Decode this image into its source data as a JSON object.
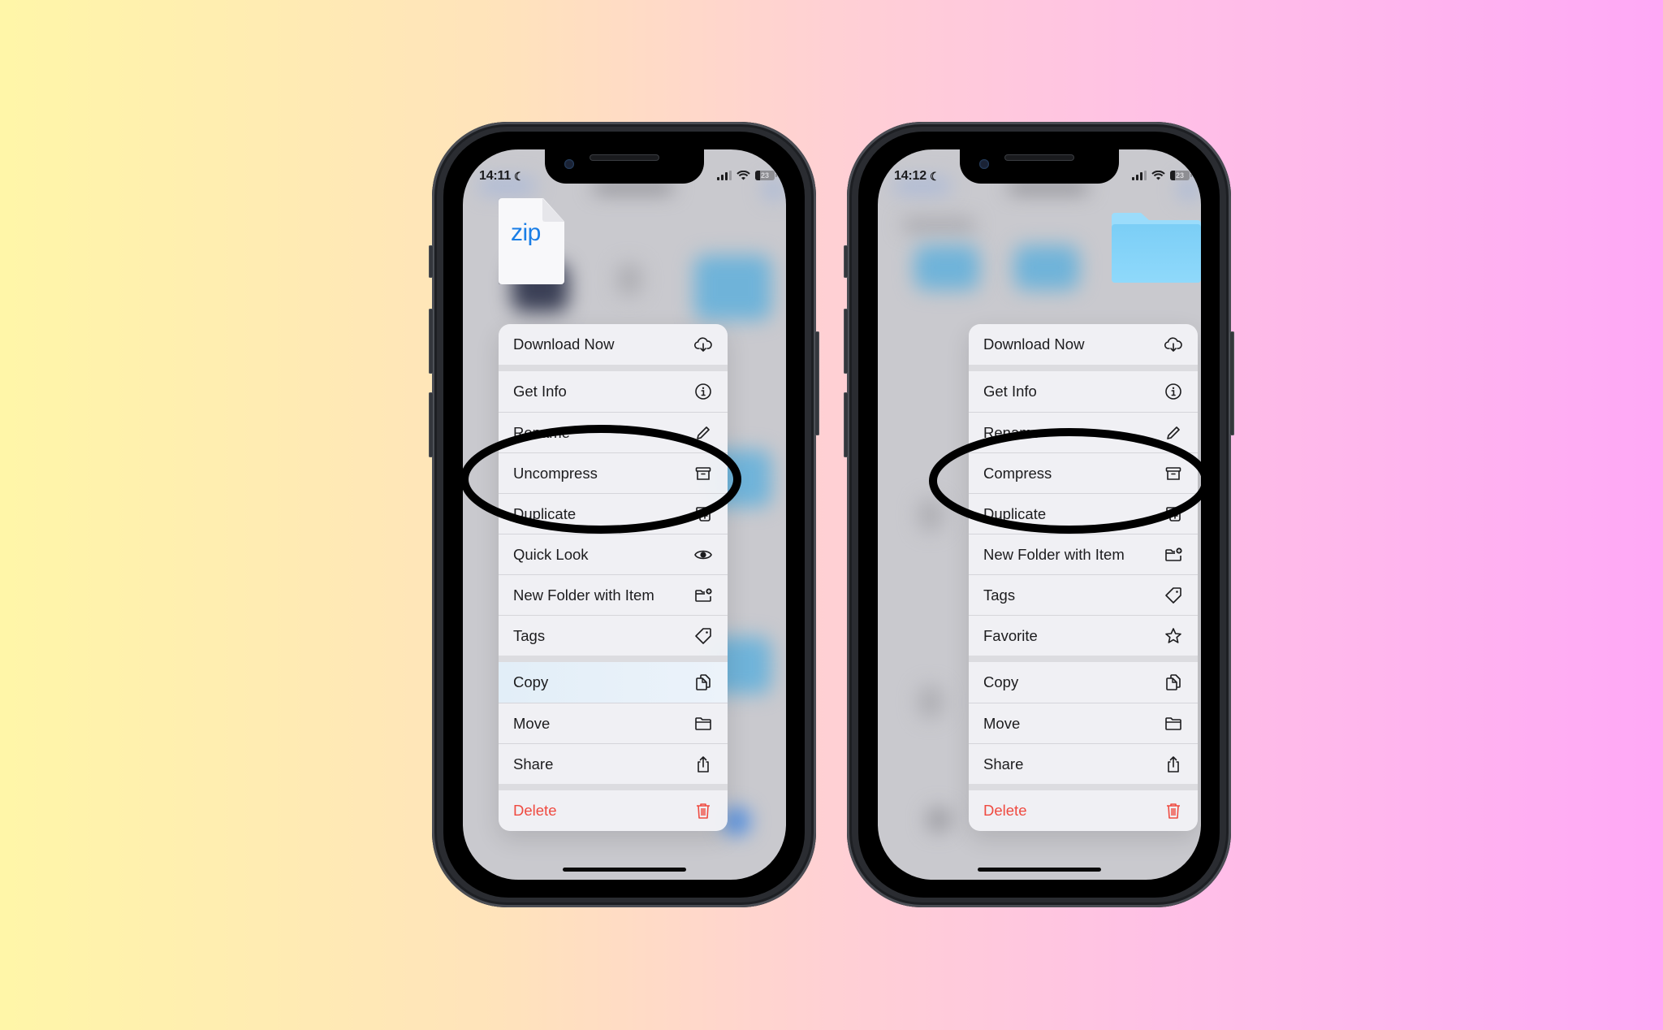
{
  "background": {
    "gradient": [
      "#fff6a8",
      "#ffe3bb",
      "#ffd0d4",
      "#ffc0e6",
      "#ffa8f6"
    ]
  },
  "annotation_color": "#000000",
  "phones": [
    {
      "status": {
        "time": "14:11",
        "focus_icon": "moon-icon",
        "battery": "23"
      },
      "preview": {
        "type": "zip-file",
        "label": "zip",
        "label_color": "#1a7ee6"
      },
      "highlighted_item": "Uncompress",
      "menu": {
        "groups": [
          [
            {
              "label": "Download Now",
              "icon": "cloud-download-icon"
            }
          ],
          [
            {
              "label": "Get Info",
              "icon": "info-circle-icon"
            },
            {
              "label": "Rename",
              "icon": "pencil-icon"
            },
            {
              "label": "Uncompress",
              "icon": "archive-box-icon"
            },
            {
              "label": "Duplicate",
              "icon": "duplicate-icon"
            },
            {
              "label": "Quick Look",
              "icon": "eye-icon"
            },
            {
              "label": "New Folder with Item",
              "icon": "folder-plus-icon"
            },
            {
              "label": "Tags",
              "icon": "tag-icon"
            }
          ],
          [
            {
              "label": "Copy",
              "icon": "copy-icon"
            },
            {
              "label": "Move",
              "icon": "folder-icon"
            },
            {
              "label": "Share",
              "icon": "share-icon"
            }
          ],
          [
            {
              "label": "Delete",
              "icon": "trash-icon",
              "destructive": true
            }
          ]
        ]
      }
    },
    {
      "status": {
        "time": "14:12",
        "focus_icon": "moon-icon",
        "battery": "23"
      },
      "preview": {
        "type": "folder",
        "color": "#7fd0f7"
      },
      "highlighted_item": "Compress",
      "menu": {
        "groups": [
          [
            {
              "label": "Download Now",
              "icon": "cloud-download-icon"
            }
          ],
          [
            {
              "label": "Get Info",
              "icon": "info-circle-icon"
            },
            {
              "label": "Rename",
              "icon": "pencil-icon"
            },
            {
              "label": "Compress",
              "icon": "archive-box-icon"
            },
            {
              "label": "Duplicate",
              "icon": "duplicate-icon"
            },
            {
              "label": "New Folder with Item",
              "icon": "folder-plus-icon"
            },
            {
              "label": "Tags",
              "icon": "tag-icon"
            },
            {
              "label": "Favorite",
              "icon": "star-icon"
            }
          ],
          [
            {
              "label": "Copy",
              "icon": "copy-icon"
            },
            {
              "label": "Move",
              "icon": "folder-icon"
            },
            {
              "label": "Share",
              "icon": "share-icon"
            }
          ],
          [
            {
              "label": "Delete",
              "icon": "trash-icon",
              "destructive": true
            }
          ]
        ]
      }
    }
  ],
  "colors": {
    "destructive": "#ef4a40",
    "text": "#1c1c1e",
    "accent": "#1a7ee6"
  }
}
